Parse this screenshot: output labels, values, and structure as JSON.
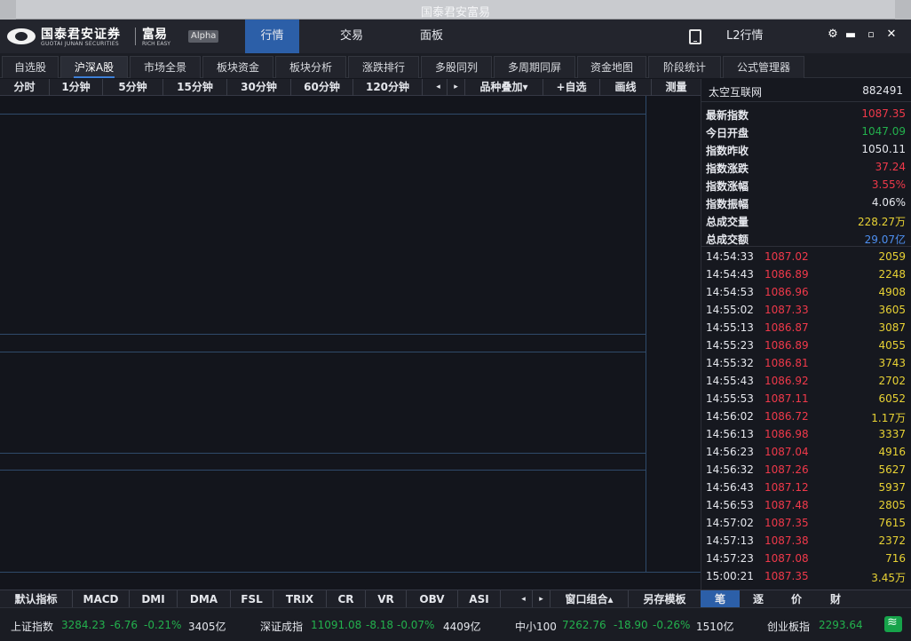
{
  "window": {
    "title": "国泰君安富易"
  },
  "brand": {
    "name_cn": "国泰君安证券",
    "name_en": "GUOTAI JUNAN SECURITIES",
    "product_cn": "富易",
    "product_en": "RICH EASY",
    "badge": "Alpha"
  },
  "topnav": {
    "tabs": [
      "行情",
      "交易",
      "面板"
    ],
    "l2": "L2行情"
  },
  "subtabs": [
    "自选股",
    "沪深A股",
    "市场全景",
    "板块资金",
    "板块分析",
    "涨跌排行",
    "多股同列",
    "多周期同屏",
    "资金地图",
    "阶段统计",
    "公式管理器"
  ],
  "periods": [
    "分时",
    "1分钟",
    "5分钟",
    "15分钟",
    "30分钟",
    "60分钟",
    "120分钟"
  ],
  "period_tools": {
    "prev": "◂",
    "next": "▸",
    "overlay": "品种叠加▾",
    "add_watch": "+自选",
    "draw": "画线",
    "measure": "测量"
  },
  "quote": {
    "name": "太空互联网",
    "code": "882491",
    "stats": [
      {
        "label": "最新指数",
        "value": "1087.35",
        "color": "#f0394a"
      },
      {
        "label": "今日开盘",
        "value": "1047.09",
        "color": "#23b14d"
      },
      {
        "label": "指数昨收",
        "value": "1050.11",
        "color": "#e6e8ee"
      },
      {
        "label": "指数涨跌",
        "value": "37.24",
        "color": "#f0394a"
      },
      {
        "label": "指数涨幅",
        "value": "3.55%",
        "color": "#f0394a"
      },
      {
        "label": "指数振幅",
        "value": "4.06%",
        "color": "#e6e8ee"
      },
      {
        "label": "总成交量",
        "value": "228.27万",
        "color": "#e8d234"
      },
      {
        "label": "总成交额",
        "value": "29.07亿",
        "color": "#4d8ff0"
      }
    ],
    "ticks": [
      {
        "time": "14:54:33",
        "price": "1087.02",
        "vol": "2059"
      },
      {
        "time": "14:54:43",
        "price": "1086.89",
        "vol": "2248"
      },
      {
        "time": "14:54:53",
        "price": "1086.96",
        "vol": "4908"
      },
      {
        "time": "14:55:02",
        "price": "1087.33",
        "vol": "3605"
      },
      {
        "time": "14:55:13",
        "price": "1086.87",
        "vol": "3087"
      },
      {
        "time": "14:55:23",
        "price": "1086.89",
        "vol": "4055"
      },
      {
        "time": "14:55:32",
        "price": "1086.81",
        "vol": "3743"
      },
      {
        "time": "14:55:43",
        "price": "1086.92",
        "vol": "2702"
      },
      {
        "time": "14:55:53",
        "price": "1087.11",
        "vol": "6052"
      },
      {
        "time": "14:56:02",
        "price": "1086.72",
        "vol": "1.17万"
      },
      {
        "time": "14:56:13",
        "price": "1086.98",
        "vol": "3337"
      },
      {
        "time": "14:56:23",
        "price": "1087.04",
        "vol": "4916"
      },
      {
        "time": "14:56:32",
        "price": "1087.26",
        "vol": "5627"
      },
      {
        "time": "14:56:43",
        "price": "1087.12",
        "vol": "5937"
      },
      {
        "time": "14:56:53",
        "price": "1087.48",
        "vol": "2805"
      },
      {
        "time": "14:57:02",
        "price": "1087.35",
        "vol": "7615"
      },
      {
        "time": "14:57:13",
        "price": "1087.38",
        "vol": "2372"
      },
      {
        "time": "14:57:23",
        "price": "1087.08",
        "vol": "716"
      },
      {
        "time": "15:00:21",
        "price": "1087.35",
        "vol": "3.45万"
      }
    ]
  },
  "indicators": [
    "默认指标",
    "MACD",
    "DMI",
    "DMA",
    "FSL",
    "TRIX",
    "CR",
    "VR",
    "OBV",
    "ASI"
  ],
  "indicator_tools": {
    "prev": "◂",
    "next": "▸",
    "window_combo": "窗口组合▴",
    "save_template": "另存模板"
  },
  "right_tabs": [
    "笔",
    "逐",
    "价",
    "财"
  ],
  "status": [
    {
      "name": "上证指数",
      "price": "3284.23",
      "chg": "-6.76",
      "pct": "-0.21%",
      "amount": "3405亿"
    },
    {
      "name": "深证成指",
      "price": "11091.08",
      "chg": "-8.18",
      "pct": "-0.07%",
      "amount": "4409亿"
    },
    {
      "name": "中小100",
      "price": "7262.76",
      "chg": "-18.90",
      "pct": "-0.26%",
      "amount": "1510亿"
    },
    {
      "name": "创业板指",
      "price": "2293.64",
      "chg": "",
      "pct": "",
      "amount": ""
    }
  ]
}
